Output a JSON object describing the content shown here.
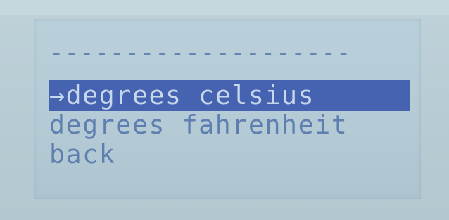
{
  "display": {
    "divider": "--------------------",
    "menu": {
      "items": [
        {
          "label": "→degrees celsius",
          "selected": true
        },
        {
          "label": "degrees fahrenheit",
          "selected": false
        },
        {
          "label": "back",
          "selected": false
        }
      ]
    }
  },
  "colors": {
    "lcd_background": "#b6ccd6",
    "text": "#5f7fb0",
    "selection_background": "#4663b1",
    "selection_text": "#c7d7ec"
  }
}
